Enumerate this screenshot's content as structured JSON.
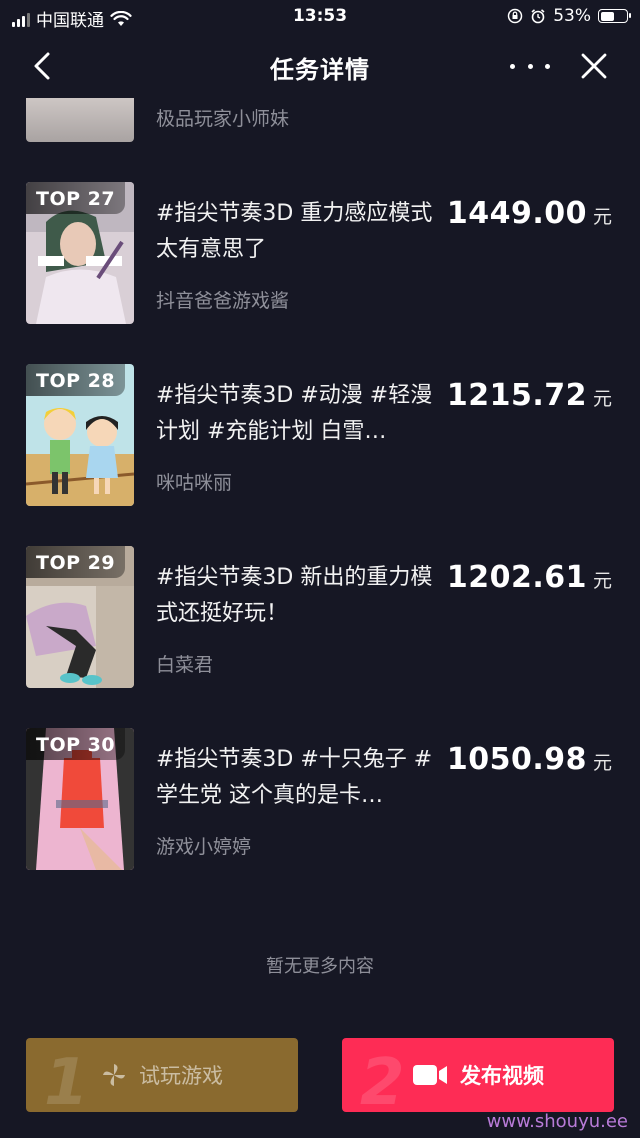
{
  "status_bar": {
    "carrier": "中国联通",
    "time": "13:53",
    "battery_percent_text": "53%",
    "battery_level": 0.53
  },
  "nav": {
    "title": "任务详情"
  },
  "partial_item": {
    "author": "极品玩家小师妹"
  },
  "items": [
    {
      "rank": "TOP 27",
      "title": "#指尖节奏3D 重力感应模式太有意思了",
      "author": "抖音爸爸游戏酱",
      "price": "1449.00",
      "unit": "元"
    },
    {
      "rank": "TOP 28",
      "title": "#指尖节奏3D #动漫 #轻漫计划 #充能计划 白雪…",
      "author": "咪咕咪丽",
      "price": "1215.72",
      "unit": "元"
    },
    {
      "rank": "TOP 29",
      "title": "#指尖节奏3D 新出的重力模式还挺好玩！",
      "author": "白菜君",
      "price": "1202.61",
      "unit": "元"
    },
    {
      "rank": "TOP 30",
      "title": "#指尖节奏3D #十只兔子 #学生党 这个真的是卡…",
      "author": "游戏小婷婷",
      "price": "1050.98",
      "unit": "元"
    }
  ],
  "footer_text": "暂无更多内容",
  "buttons": {
    "try_step": "1",
    "try_label": "试玩游戏",
    "publish_step": "2",
    "publish_label": "发布视频"
  },
  "watermark": "www.shouyu.ee",
  "colors": {
    "background": "#161724",
    "publish_button": "#fe2c55",
    "try_button": "#8a6a2f",
    "secondary_text": "#8e8f99"
  }
}
